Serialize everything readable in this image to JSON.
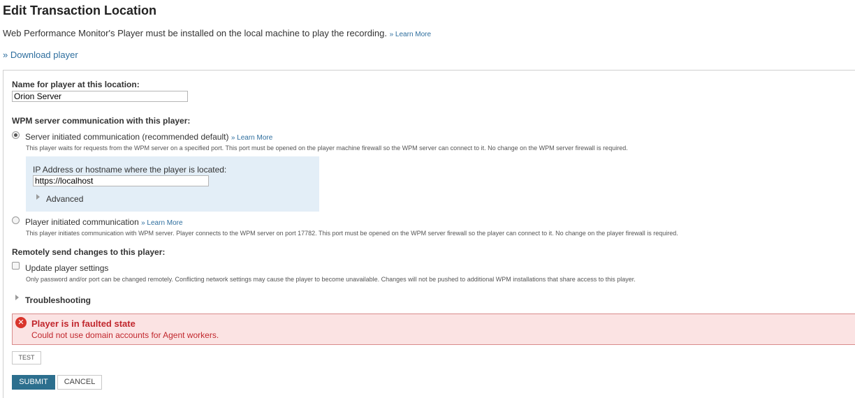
{
  "header": {
    "title": "Edit Transaction Location",
    "intro": "Web Performance Monitor's Player must be installed on the local machine to play the recording.",
    "intro_learn_more": "» Learn More",
    "download_link": "» Download player"
  },
  "form": {
    "name_label": "Name for player at this location:",
    "name_value": "Orion Server",
    "comm_heading": "WPM server communication with this player:",
    "server_option": {
      "label": "Server initiated communication (recommended default)",
      "learn_more": "» Learn More",
      "description": "This player waits for requests from the WPM server on a specified port. This port must be opened on the player machine firewall so the WPM server can connect to it. No change on the WPM server firewall is required.",
      "selected": true
    },
    "ip_box": {
      "label": "IP Address or hostname where the player is located:",
      "value": "https://localhost",
      "advanced_label": "Advanced"
    },
    "player_option": {
      "label": "Player initiated communication",
      "learn_more": "» Learn More",
      "description": "This player initiates communication with WPM server. Player connects to the WPM server on port 17782. This port must be opened on the WPM server firewall so the player can connect to it. No change on the player firewall is required.",
      "selected": false
    },
    "remote_heading": "Remotely send changes to this player:",
    "update_settings": {
      "label": "Update player settings",
      "description": "Only password and/or port can be changed remotely. Conflicting network settings may cause the player to become unavailable. Changes will not be pushed to additional WPM installations that share access to this player.",
      "checked": false
    },
    "troubleshooting_label": "Troubleshooting"
  },
  "error": {
    "icon": "error-x-icon",
    "title": "Player is in faulted state",
    "message": "Could not use domain accounts for Agent workers."
  },
  "buttons": {
    "test": "TEST",
    "submit": "SUBMIT",
    "cancel": "CANCEL"
  },
  "colors": {
    "link": "#2e6e9e",
    "ip_box_bg": "#e3eef7",
    "error_bg": "#fbe3e3",
    "error_text": "#c1272d",
    "submit_bg": "#2c6f8e"
  }
}
